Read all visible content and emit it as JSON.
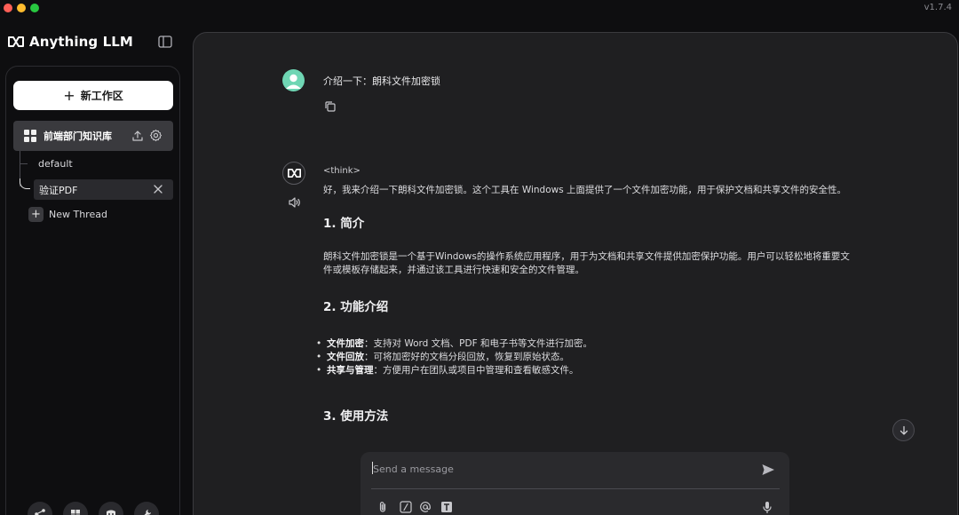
{
  "app": {
    "name": "Anything LLM",
    "version": "v1.7.4"
  },
  "sidebar": {
    "new_workspace_label": "新工作区",
    "workspace": {
      "label": "前端部门知识库"
    },
    "threads": [
      {
        "label": "default"
      },
      {
        "label": "验证PDF"
      }
    ],
    "new_thread_label": "New Thread"
  },
  "chat": {
    "user_message": "介绍一下：朗科文件加密锁",
    "think_tag": "<think>",
    "intro": "好，我来介绍一下朗科文件加密锁。这个工具在 Windows 上面提供了一个文件加密功能，用于保护文档和共享文件的安全性。",
    "section1_title": "1. 简介",
    "section1_body_line1": "朗科文件加密锁是一个基于Windows的操作系统应用程序，用于为文档和共享文件提供加密保护功能。用户可以轻松地将重要文",
    "section1_body_line2": "件或模板存储起来，并通过该工具进行快速和安全的文件管理。",
    "section2_title": "2. 功能介绍",
    "features": [
      {
        "name": "文件加密",
        "desc": "：支持对 Word 文档、PDF 和电子书等文件进行加密。"
      },
      {
        "name": "文件回放",
        "desc": "：可将加密好的文档分段回放，恢复到原始状态。"
      },
      {
        "name": "共享与管理",
        "desc": "：方便用户在团队或项目中管理和查看敏感文件。"
      }
    ],
    "section3_title": "3. 使用方法"
  },
  "composer": {
    "placeholder": "Send a message"
  },
  "colors": {
    "accent_avatar": "#6fd6b4",
    "background": "#1f1f21",
    "sidebar_bg": "#0e0e10"
  }
}
